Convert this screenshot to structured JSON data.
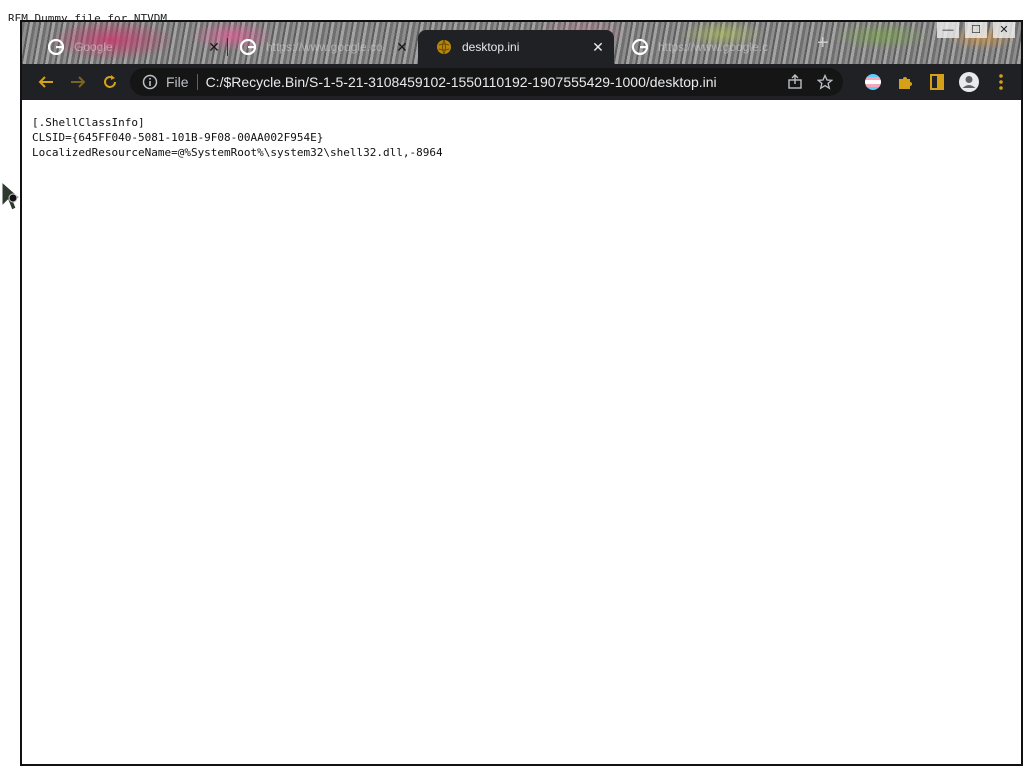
{
  "background": {
    "text": "REM Dummy file for NTVDM"
  },
  "tabs": [
    {
      "title": "Google",
      "icon": "google-icon",
      "active": false
    },
    {
      "title": "https://www.google.co",
      "icon": "google-icon",
      "active": false
    },
    {
      "title": "desktop.ini",
      "icon": "file-globe-icon",
      "active": true
    },
    {
      "title": "https://www.google.c",
      "icon": "google-icon",
      "active": false
    }
  ],
  "toolbar": {
    "scheme": "File",
    "url": "C:/$Recycle.Bin/S-1-5-21-3108459102-1550110192-1907555429-1000/desktop.ini"
  },
  "content": {
    "lines": [
      "[.ShellClassInfo]",
      "CLSID={645FF040-5081-101B-9F08-00AA002F954E}",
      "LocalizedResourceName=@%SystemRoot%\\system32\\shell32.dll,-8964"
    ]
  },
  "colors": {
    "accent": "#d4a017",
    "toolbar_bg": "#202124",
    "omnibox_bg": "#151515"
  }
}
